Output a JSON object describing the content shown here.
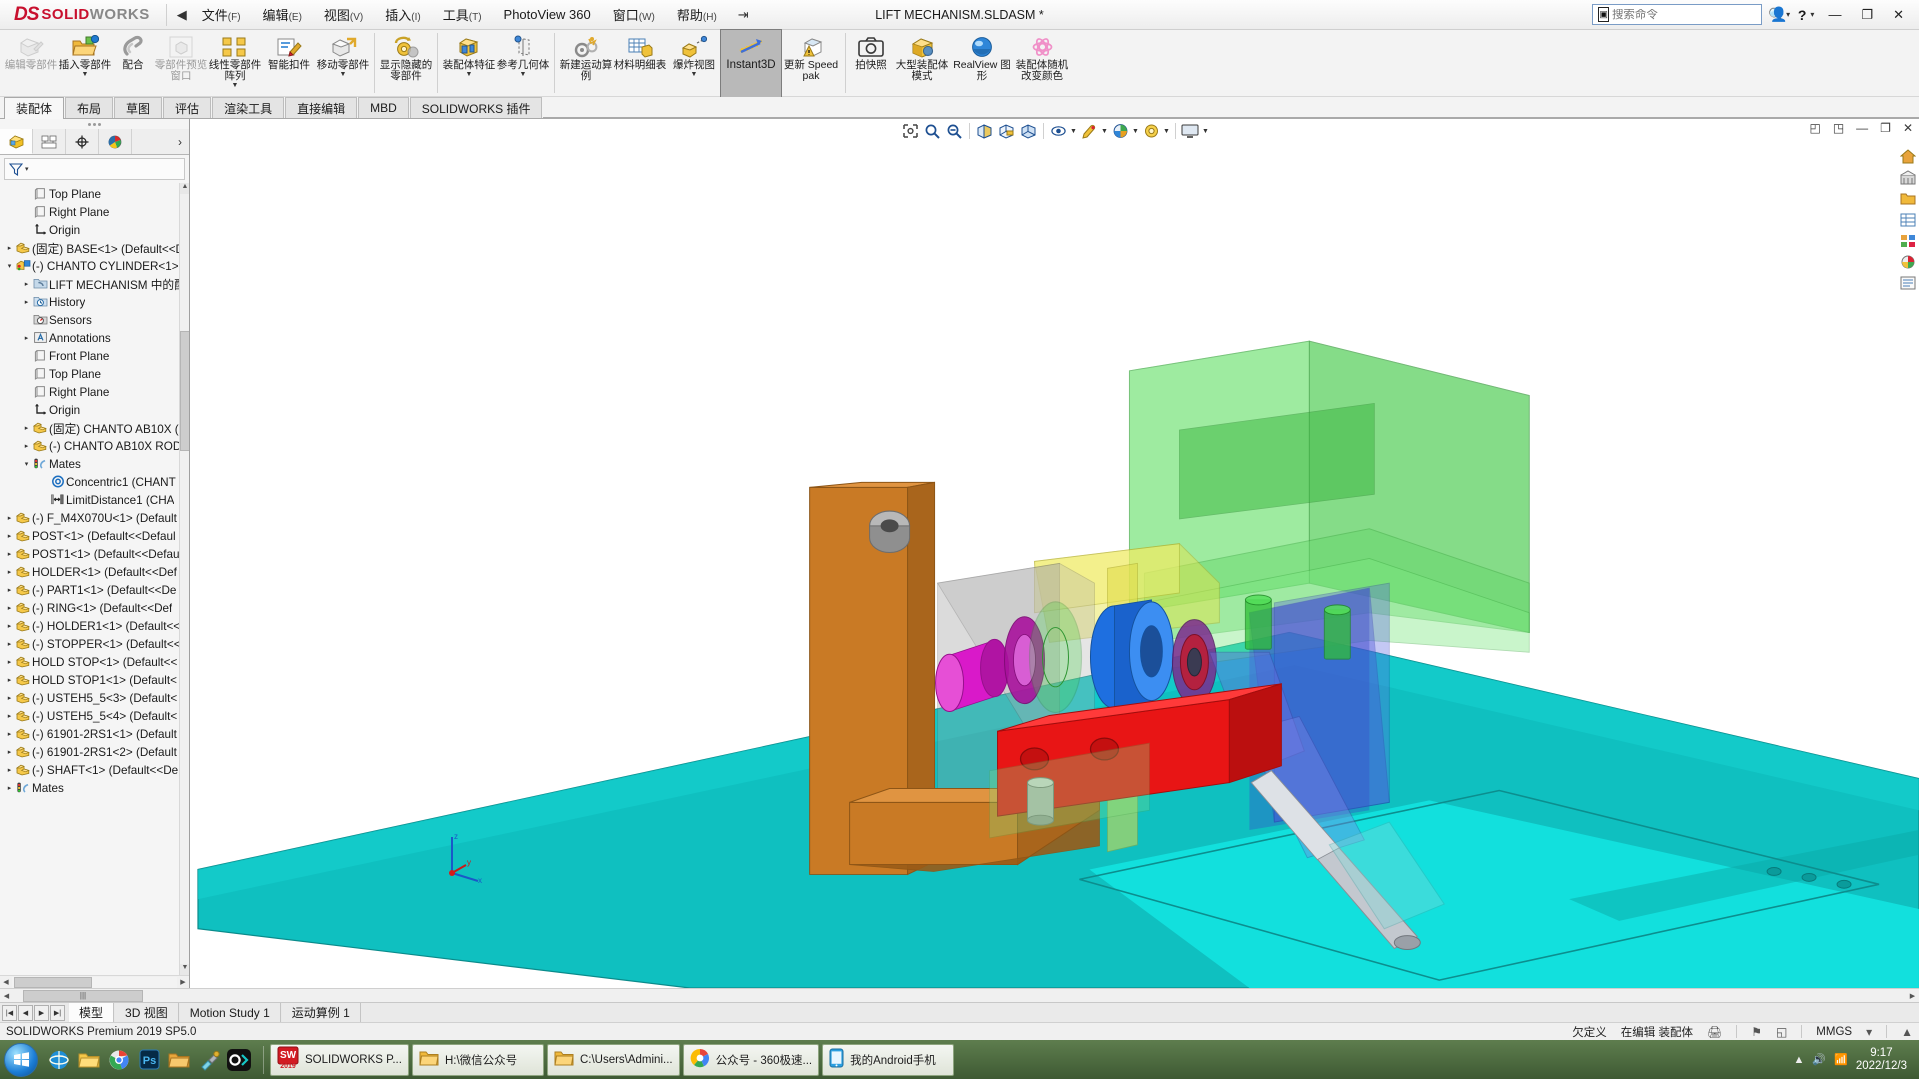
{
  "titlebar": {
    "logo_ds": "DS",
    "logo_solid": "SOLID",
    "logo_works": "WORKS",
    "collapse_icon": "◀",
    "menus": [
      {
        "label": "文件",
        "key": "(F)"
      },
      {
        "label": "编辑",
        "key": "(E)"
      },
      {
        "label": "视图",
        "key": "(V)"
      },
      {
        "label": "插入",
        "key": "(I)"
      },
      {
        "label": "工具",
        "key": "(T)"
      },
      {
        "label": "PhotoView 360",
        "key": ""
      },
      {
        "label": "窗口",
        "key": "(W)"
      },
      {
        "label": "帮助",
        "key": "(H)"
      }
    ],
    "pin_icon": "⇥",
    "document_title": "LIFT MECHANISM.SLDASM *",
    "search_placeholder": "搜索命令",
    "search_value": "",
    "search_icon": "search-icon",
    "command_icon": "▣",
    "user_icon": "user-icon",
    "help_label": "?",
    "minimize": "—",
    "restore": "❐",
    "close": "✕"
  },
  "ribbon": {
    "buttons": [
      {
        "name": "edit-component",
        "label": "编辑零部件",
        "icon": "✎",
        "dropdown": false,
        "disabled": true,
        "wide": true
      },
      {
        "name": "insert-components",
        "label": "插入零部件",
        "icon": "📂",
        "dropdown": true,
        "disabled": false,
        "wide": true
      },
      {
        "name": "mate",
        "label": "配合",
        "icon": "🖇",
        "dropdown": false,
        "disabled": false,
        "wide": false
      },
      {
        "name": "component-preview-window",
        "label": "零部件预览窗口",
        "icon": "🗔",
        "dropdown": false,
        "disabled": true,
        "wide": true
      },
      {
        "name": "linear-component-pattern",
        "label": "线性零部件阵列",
        "icon": "▫▫",
        "dropdown": true,
        "disabled": false,
        "wide": true
      },
      {
        "name": "smart-fasteners",
        "label": "智能扣件",
        "icon": "📝",
        "dropdown": false,
        "disabled": false,
        "wide": true
      },
      {
        "name": "move-component",
        "label": "移动零部件",
        "icon": "📦",
        "dropdown": true,
        "disabled": false,
        "wide": true
      },
      {
        "name": "show-hidden-components",
        "label": "显示隐藏的零部件",
        "icon": "🔄",
        "dropdown": false,
        "disabled": false,
        "wide": true,
        "sep_before": true
      },
      {
        "name": "assembly-features",
        "label": "装配体特征",
        "icon": "🧱",
        "dropdown": true,
        "disabled": false,
        "wide": true,
        "sep_before": true
      },
      {
        "name": "reference-geometry",
        "label": "参考几何体",
        "icon": "⊿",
        "dropdown": true,
        "disabled": false,
        "wide": true
      },
      {
        "name": "new-motion-study",
        "label": "新建运动算例",
        "icon": "⚙",
        "dropdown": false,
        "disabled": false,
        "wide": true,
        "sep_before": true
      },
      {
        "name": "bill-of-materials",
        "label": "材料明细表",
        "icon": "▤",
        "dropdown": false,
        "disabled": false,
        "wide": true
      },
      {
        "name": "exploded-view",
        "label": "爆炸视图",
        "icon": "💥",
        "dropdown": true,
        "disabled": false,
        "wide": true
      },
      {
        "name": "instant3d",
        "label": "Instant3D",
        "icon": "📐",
        "dropdown": false,
        "disabled": false,
        "wide": true,
        "active": true
      },
      {
        "name": "update-speedpak",
        "label": "更新 Speedpak",
        "icon": "⚠",
        "dropdown": false,
        "disabled": false,
        "wide": true
      },
      {
        "name": "take-snapshot",
        "label": "拍快照",
        "icon": "📷",
        "dropdown": false,
        "disabled": false,
        "wide": false,
        "sep_before": true
      },
      {
        "name": "large-assembly-mode",
        "label": "大型装配体模式",
        "icon": "🟡",
        "dropdown": false,
        "disabled": false,
        "wide": true
      },
      {
        "name": "realview-graphics",
        "label": "RealView 图形",
        "icon": "🔵",
        "dropdown": false,
        "disabled": false,
        "wide": true
      },
      {
        "name": "assembly-random-color",
        "label": "装配体随机改变颜色",
        "icon": "✺",
        "dropdown": false,
        "disabled": false,
        "wide": true
      }
    ]
  },
  "command_tabs": {
    "tabs": [
      "装配体",
      "布局",
      "草图",
      "评估",
      "渲染工具",
      "直接编辑",
      "MBD",
      "SOLIDWORKS 插件"
    ],
    "selected": "装配体"
  },
  "view_toolbar": {
    "buttons": [
      {
        "name": "zoom-to-fit-icon",
        "glyph": "⊕",
        "dropdown": false
      },
      {
        "name": "zoom-to-area-icon",
        "glyph": "🔍",
        "dropdown": false
      },
      {
        "name": "previous-view-icon",
        "glyph": "🔎",
        "dropdown": false
      },
      {
        "name": "section-view-icon",
        "glyph": "◧",
        "dropdown": false
      },
      {
        "name": "view-orientation-icon",
        "glyph": "◩",
        "dropdown": false
      },
      {
        "name": "display-style-icon",
        "glyph": "◪",
        "dropdown": false
      },
      {
        "name": "hide-show-items-icon",
        "glyph": "◫",
        "dropdown": true
      },
      {
        "name": "edit-appearance-icon",
        "glyph": "◨",
        "dropdown": true
      },
      {
        "name": "apply-scene-icon",
        "glyph": "◐",
        "dropdown": true
      },
      {
        "name": "view-settings-icon",
        "glyph": "◉",
        "dropdown": true
      },
      {
        "name": "viewport-icon",
        "glyph": "🖵",
        "dropdown": true
      }
    ],
    "window_controls": [
      "◰",
      "◳",
      "—",
      "❐",
      "✕"
    ]
  },
  "right_toolbar": {
    "buttons": [
      {
        "name": "home-icon",
        "glyph": "🏠"
      },
      {
        "name": "assembly-tools-icon",
        "glyph": "🏛"
      },
      {
        "name": "file-explorer-icon",
        "glyph": "📁"
      },
      {
        "name": "view-palette-icon",
        "glyph": "▤"
      },
      {
        "name": "appearances-icon",
        "glyph": "▦"
      },
      {
        "name": "custom-properties-icon",
        "glyph": "🎨"
      },
      {
        "name": "design-library-icon",
        "glyph": "📑"
      }
    ]
  },
  "left_panel": {
    "tabs": [
      {
        "name": "feature-manager-tab",
        "glyph": "🟨",
        "selected": true
      },
      {
        "name": "property-manager-tab",
        "glyph": "▤",
        "selected": false
      },
      {
        "name": "configuration-manager-tab",
        "glyph": "✥",
        "selected": false
      },
      {
        "name": "display-manager-tab",
        "glyph": "🎨",
        "selected": false
      }
    ],
    "more_icon": "›",
    "filter_icon": "filter-icon",
    "filter_value": "",
    "tree": [
      {
        "indent": 1,
        "arrow": "",
        "icon": "plane",
        "label": "Top Plane"
      },
      {
        "indent": 1,
        "arrow": "",
        "icon": "plane",
        "label": "Right Plane"
      },
      {
        "indent": 1,
        "arrow": "",
        "icon": "origin",
        "label": "Origin"
      },
      {
        "indent": 0,
        "arrow": "▸",
        "icon": "part",
        "label": "(固定) BASE<1> (Default<<D"
      },
      {
        "indent": 0,
        "arrow": "▾",
        "icon": "subassy",
        "label": "(-) CHANTO CYLINDER<1>"
      },
      {
        "indent": 1,
        "arrow": "▸",
        "icon": "folder-blue",
        "label": "LIFT MECHANISM 中的配"
      },
      {
        "indent": 1,
        "arrow": "▸",
        "icon": "history",
        "label": "History"
      },
      {
        "indent": 1,
        "arrow": "",
        "icon": "sensors",
        "label": "Sensors"
      },
      {
        "indent": 1,
        "arrow": "▸",
        "icon": "annotations",
        "label": "Annotations"
      },
      {
        "indent": 1,
        "arrow": "",
        "icon": "plane",
        "label": "Front Plane"
      },
      {
        "indent": 1,
        "arrow": "",
        "icon": "plane",
        "label": "Top Plane"
      },
      {
        "indent": 1,
        "arrow": "",
        "icon": "plane",
        "label": "Right Plane"
      },
      {
        "indent": 1,
        "arrow": "",
        "icon": "origin",
        "label": "Origin"
      },
      {
        "indent": 1,
        "arrow": "▸",
        "icon": "part",
        "label": "(固定) CHANTO AB10X ("
      },
      {
        "indent": 1,
        "arrow": "▸",
        "icon": "part",
        "label": "(-) CHANTO AB10X ROD"
      },
      {
        "indent": 1,
        "arrow": "▾",
        "icon": "mates",
        "label": "Mates"
      },
      {
        "indent": 2,
        "arrow": "",
        "icon": "concentric",
        "label": "Concentric1 (CHANT"
      },
      {
        "indent": 2,
        "arrow": "",
        "icon": "distance",
        "label": "LimitDistance1 (CHA"
      },
      {
        "indent": 0,
        "arrow": "▸",
        "icon": "part",
        "label": "(-) F_M4X070U<1> (Default"
      },
      {
        "indent": 0,
        "arrow": "▸",
        "icon": "part",
        "label": "POST<1> (Default<<Defaul"
      },
      {
        "indent": 0,
        "arrow": "▸",
        "icon": "part",
        "label": "POST1<1> (Default<<Defau"
      },
      {
        "indent": 0,
        "arrow": "▸",
        "icon": "part",
        "label": "HOLDER<1> (Default<<Def"
      },
      {
        "indent": 0,
        "arrow": "▸",
        "icon": "part",
        "label": "(-) PART1<1> (Default<<De"
      },
      {
        "indent": 0,
        "arrow": "▸",
        "icon": "part",
        "label": "(-) RING<1> (Default<<Def"
      },
      {
        "indent": 0,
        "arrow": "▸",
        "icon": "part",
        "label": "(-) HOLDER1<1> (Default<<"
      },
      {
        "indent": 0,
        "arrow": "▸",
        "icon": "part",
        "label": "(-) STOPPER<1> (Default<<"
      },
      {
        "indent": 0,
        "arrow": "▸",
        "icon": "part",
        "label": "HOLD STOP<1> (Default<<"
      },
      {
        "indent": 0,
        "arrow": "▸",
        "icon": "part",
        "label": "HOLD STOP1<1> (Default<"
      },
      {
        "indent": 0,
        "arrow": "▸",
        "icon": "part",
        "label": "(-) USTEH5_5<3> (Default<"
      },
      {
        "indent": 0,
        "arrow": "▸",
        "icon": "part",
        "label": "(-) USTEH5_5<4> (Default<"
      },
      {
        "indent": 0,
        "arrow": "▸",
        "icon": "part",
        "label": "(-) 61901-2RS1<1> (Default"
      },
      {
        "indent": 0,
        "arrow": "▸",
        "icon": "part",
        "label": "(-) 61901-2RS1<2> (Default"
      },
      {
        "indent": 0,
        "arrow": "▸",
        "icon": "part",
        "label": "(-) SHAFT<1> (Default<<De"
      },
      {
        "indent": 0,
        "arrow": "▸",
        "icon": "mates",
        "label": "Mates"
      }
    ]
  },
  "doc_tabs": {
    "nav": [
      "|◀",
      "◀",
      "▶",
      "▶|"
    ],
    "tabs": [
      "模型",
      "3D 视图",
      "Motion Study 1",
      "运动算例 1"
    ],
    "selected": "模型"
  },
  "statusbar": {
    "left": "SOLIDWORKS Premium 2019 SP5.0",
    "under_defined": "欠定义",
    "editing": "在编辑 装配体",
    "units": "MMGS",
    "print_icon": "🖨",
    "flag_icon": "⚑",
    "expand_icon": "▲"
  },
  "taskbar": {
    "start_glyph": "⊞",
    "quick_launch": [
      {
        "name": "ie-icon",
        "glyph": "🌐"
      },
      {
        "name": "explorer-icon",
        "glyph": "📁"
      },
      {
        "name": "chrome-icon",
        "glyph": "◎"
      },
      {
        "name": "photoshop-icon",
        "glyph": "Ps"
      },
      {
        "name": "folder2-icon",
        "glyph": "🗂"
      },
      {
        "name": "screwdriver-icon",
        "glyph": "🔧"
      },
      {
        "name": "ocr-icon",
        "glyph": "ƆK"
      }
    ],
    "tasks": [
      {
        "name": "taskbar-solidworks",
        "icon": "SW",
        "label": "SOLIDWORKS P...",
        "active": true
      },
      {
        "name": "taskbar-folder-wechat",
        "icon": "📁",
        "label": "H:\\微信公众号",
        "active": false
      },
      {
        "name": "taskbar-folder-users",
        "icon": "📁",
        "label": "C:\\Users\\Admini...",
        "active": false
      },
      {
        "name": "taskbar-360browser",
        "icon": "🌈",
        "label": "公众号 - 360极速...",
        "active": false
      },
      {
        "name": "taskbar-android-phone",
        "icon": "📱",
        "label": "我的Android手机",
        "active": false
      }
    ],
    "tray": [
      "▲",
      "🔊",
      "🌐"
    ],
    "clock_time": "9:17",
    "clock_date": "2022/12/3"
  }
}
